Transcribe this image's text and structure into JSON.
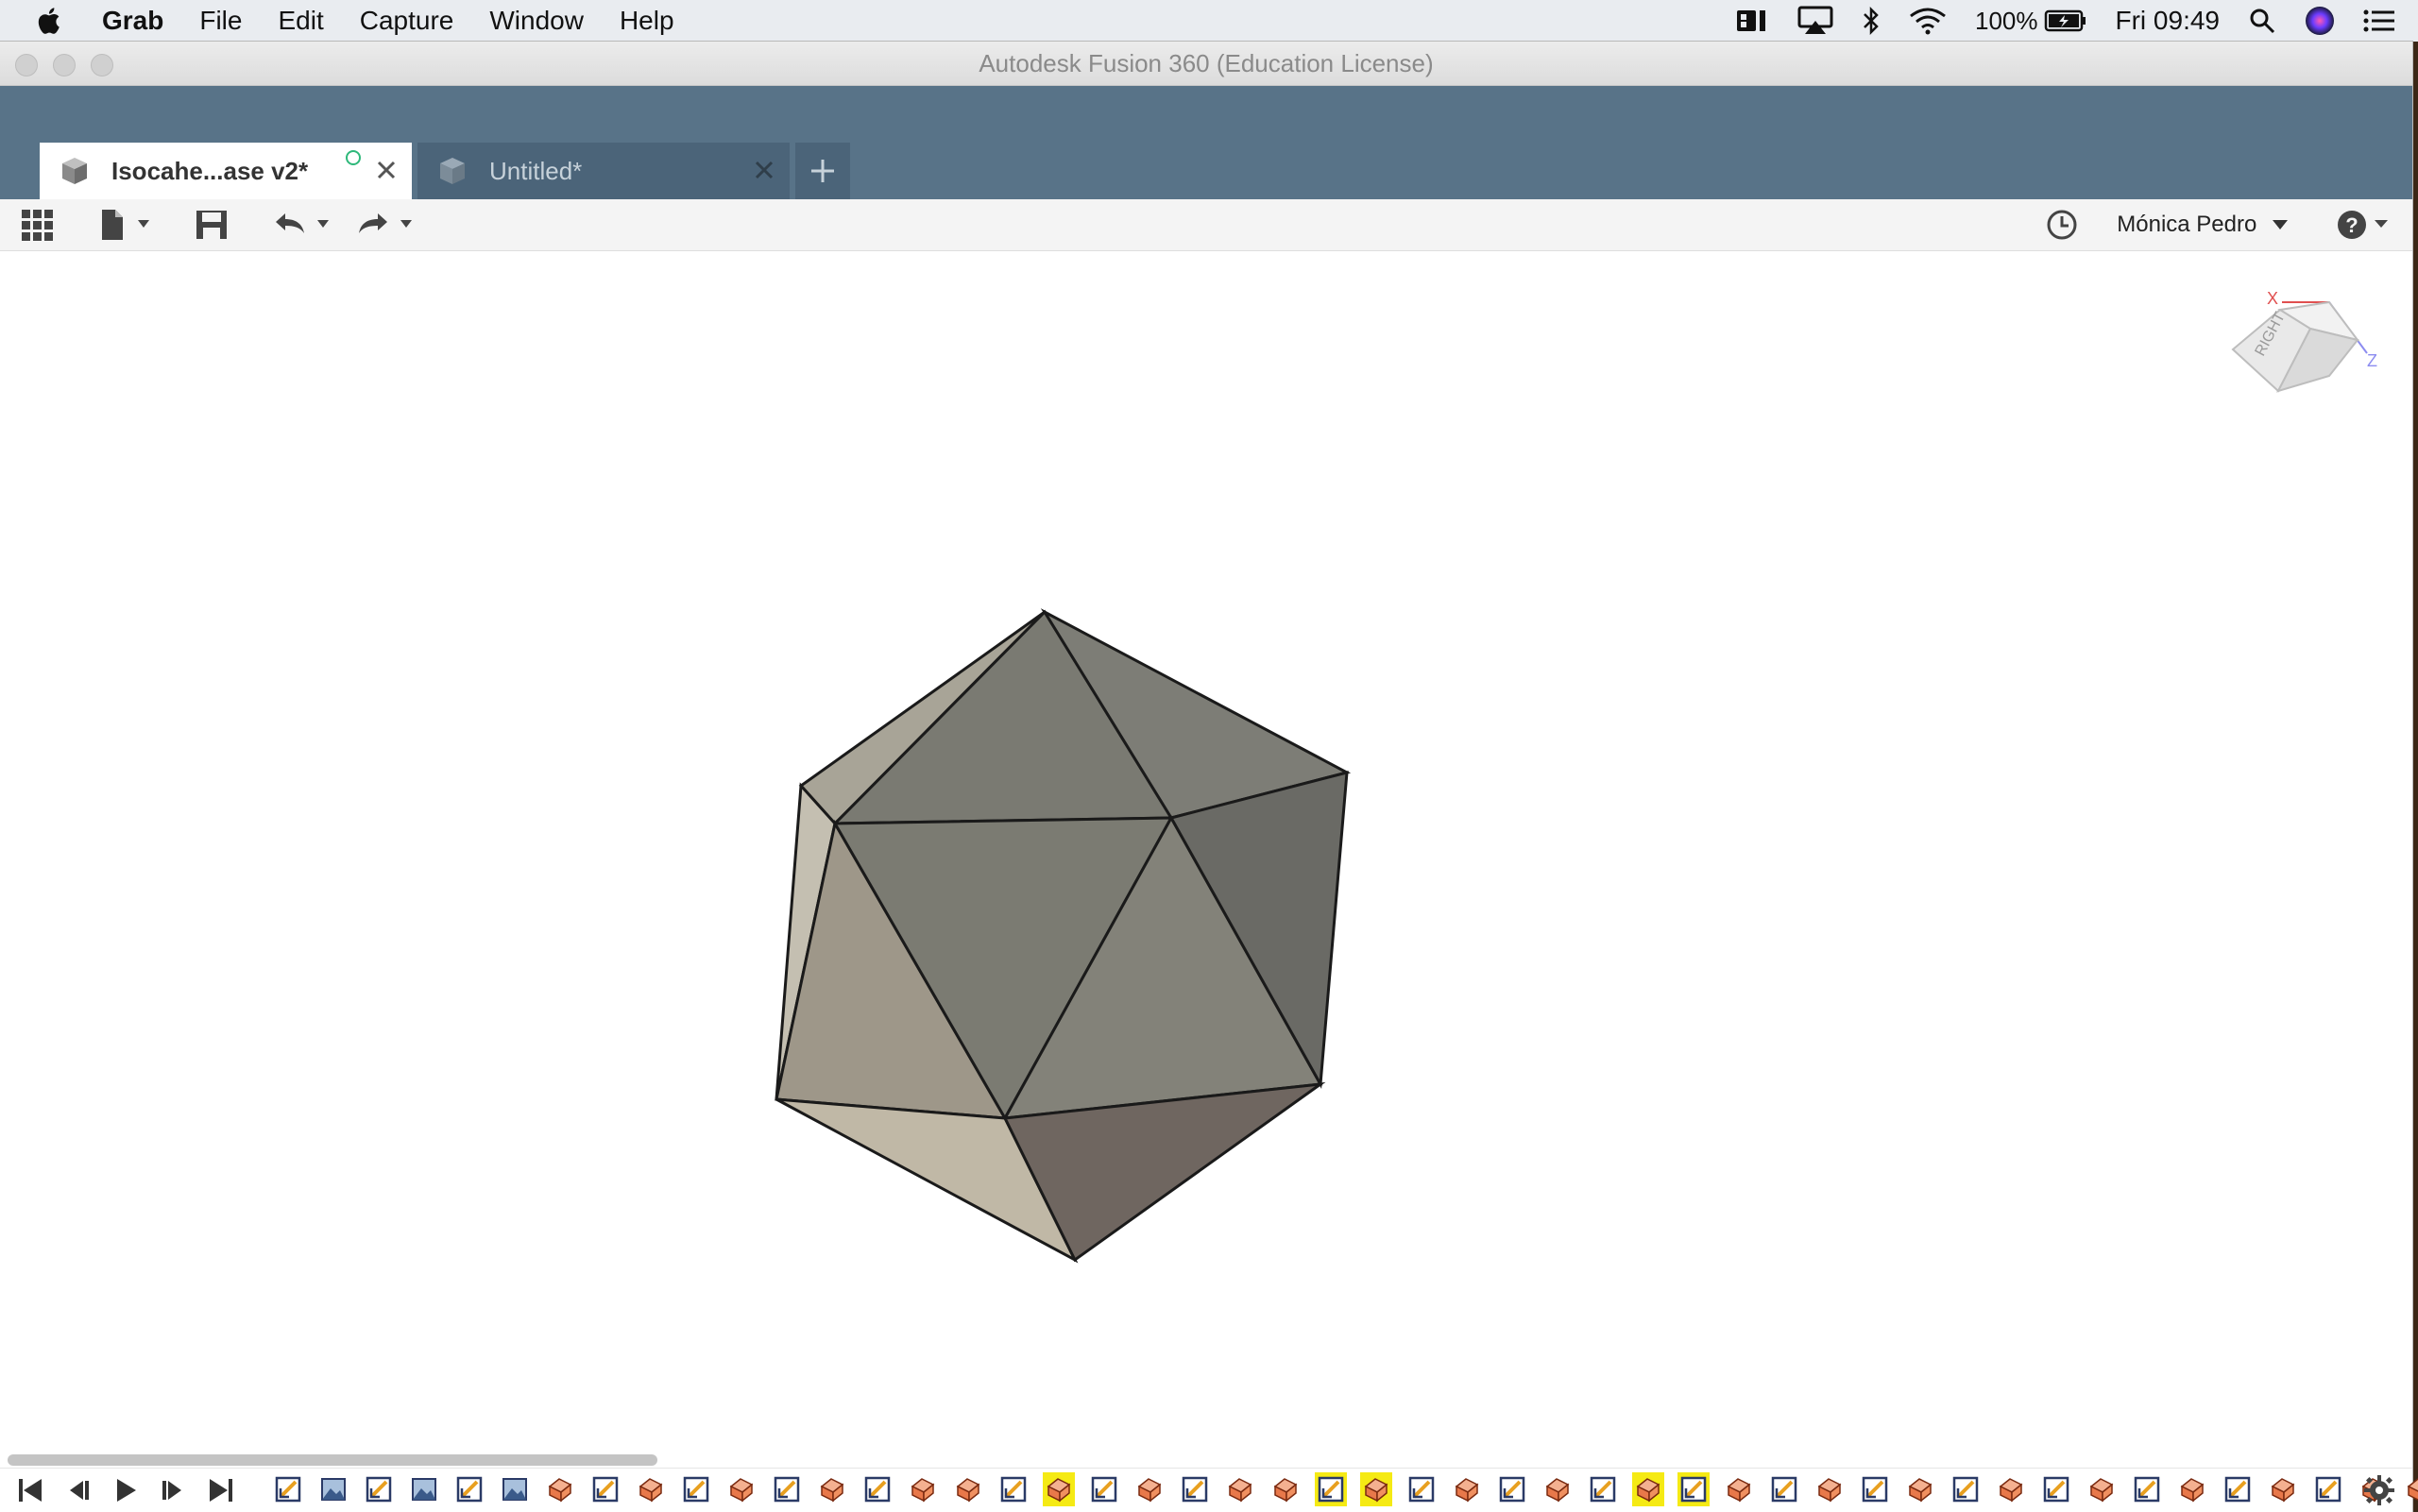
{
  "menubar": {
    "app_name": "Grab",
    "items": [
      "File",
      "Edit",
      "Capture",
      "Window",
      "Help"
    ],
    "battery": "100%",
    "clock": "Fri 09:49"
  },
  "window": {
    "title": "Autodesk Fusion 360 (Education License)"
  },
  "tabs": [
    {
      "label": "Isocahe...ase v2*",
      "active": true
    },
    {
      "label": "Untitled*",
      "active": false
    }
  ],
  "toolbar": {
    "user_name": "Mónica Pedro"
  },
  "viewcube": {
    "face_label": "RIGHT",
    "axis_x": "X",
    "axis_z": "Z"
  },
  "timeline": {
    "features": [
      "sketch",
      "plane",
      "sketch",
      "plane",
      "sketch",
      "plane",
      "extrude",
      "sketch",
      "extrude",
      "sketch",
      "extrude",
      "sketch",
      "extrude",
      "sketch",
      "extrude",
      "extrude",
      "sketch",
      "extrude",
      "sketch",
      "extrude",
      "sketch",
      "extrude",
      "extrude",
      "sketch",
      "extrude",
      "sketch",
      "extrude",
      "sketch",
      "extrude",
      "sketch",
      "extrude",
      "sketch",
      "extrude",
      "sketch",
      "extrude",
      "sketch",
      "extrude",
      "sketch",
      "extrude",
      "sketch",
      "extrude",
      "sketch",
      "extrude",
      "sketch",
      "extrude",
      "sketch",
      "extrude",
      "extrude",
      "sketch"
    ],
    "highlighted": [
      17,
      23,
      24,
      30,
      31
    ],
    "highlight_color": "#f5ea14"
  },
  "colors": {
    "tabbar": "#587388",
    "accent_green": "#2eb87a",
    "timeline_highlight": "#f5ea14"
  }
}
